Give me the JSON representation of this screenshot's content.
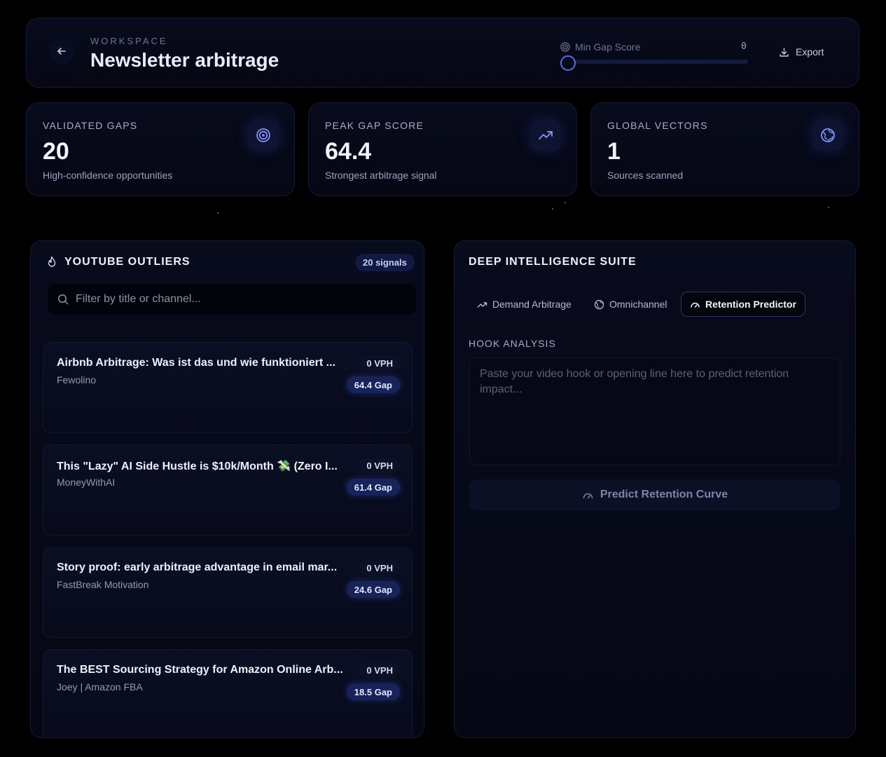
{
  "header": {
    "eyebrow": "WORKSPACE",
    "title": "Newsletter arbitrage",
    "slider_label": "Min Gap Score",
    "slider_value": "0",
    "slider_fraction": 0,
    "export_label": "Export"
  },
  "stats": [
    {
      "label": "VALIDATED GAPS",
      "value": "20",
      "sub": "High-confidence opportunities",
      "icon": "target-icon"
    },
    {
      "label": "PEAK GAP SCORE",
      "value": "64.4",
      "sub": "Strongest arbitrage signal",
      "icon": "trending-up-icon"
    },
    {
      "label": "GLOBAL VECTORS",
      "value": "1",
      "sub": "Sources scanned",
      "icon": "globe-icon"
    }
  ],
  "youtube": {
    "title": "YOUTUBE OUTLIERS",
    "badge": "20 signals",
    "search_placeholder": "Filter by title or channel...",
    "items": [
      {
        "title": "Airbnb Arbitrage: Was ist das und wie funktioniert ...",
        "channel": "Fewolino",
        "vph": "0 VPH",
        "gap": "64.4 Gap"
      },
      {
        "title": "This \"Lazy\" AI Side Hustle is $10k/Month 💸 (Zero I...",
        "channel": "MoneyWithAI",
        "vph": "0 VPH",
        "gap": "61.4 Gap"
      },
      {
        "title": "Story proof: early arbitrage advantage in email mar...",
        "channel": "FastBreak Motivation",
        "vph": "0 VPH",
        "gap": "24.6 Gap"
      },
      {
        "title": "The BEST Sourcing Strategy for Amazon Online Arb...",
        "channel": "Joey | Amazon FBA",
        "vph": "0 VPH",
        "gap": "18.5 Gap"
      }
    ]
  },
  "deep": {
    "title": "DEEP INTELLIGENCE SUITE",
    "tabs": [
      {
        "label": "Demand Arbitrage",
        "icon": "trending-up-icon"
      },
      {
        "label": "Omnichannel",
        "icon": "globe-icon"
      },
      {
        "label": "Retention Predictor",
        "icon": "gauge-icon"
      }
    ],
    "active_tab": "Retention Predictor",
    "hook_label": "HOOK ANALYSIS",
    "hook_placeholder": "Paste your video hook or opening line here to predict retention impact...",
    "predict_label": "Predict Retention Curve"
  },
  "colors": {
    "background": "#000000",
    "panel": "#070a1a",
    "accent": "#5a6de0",
    "badge": "#17235a"
  }
}
